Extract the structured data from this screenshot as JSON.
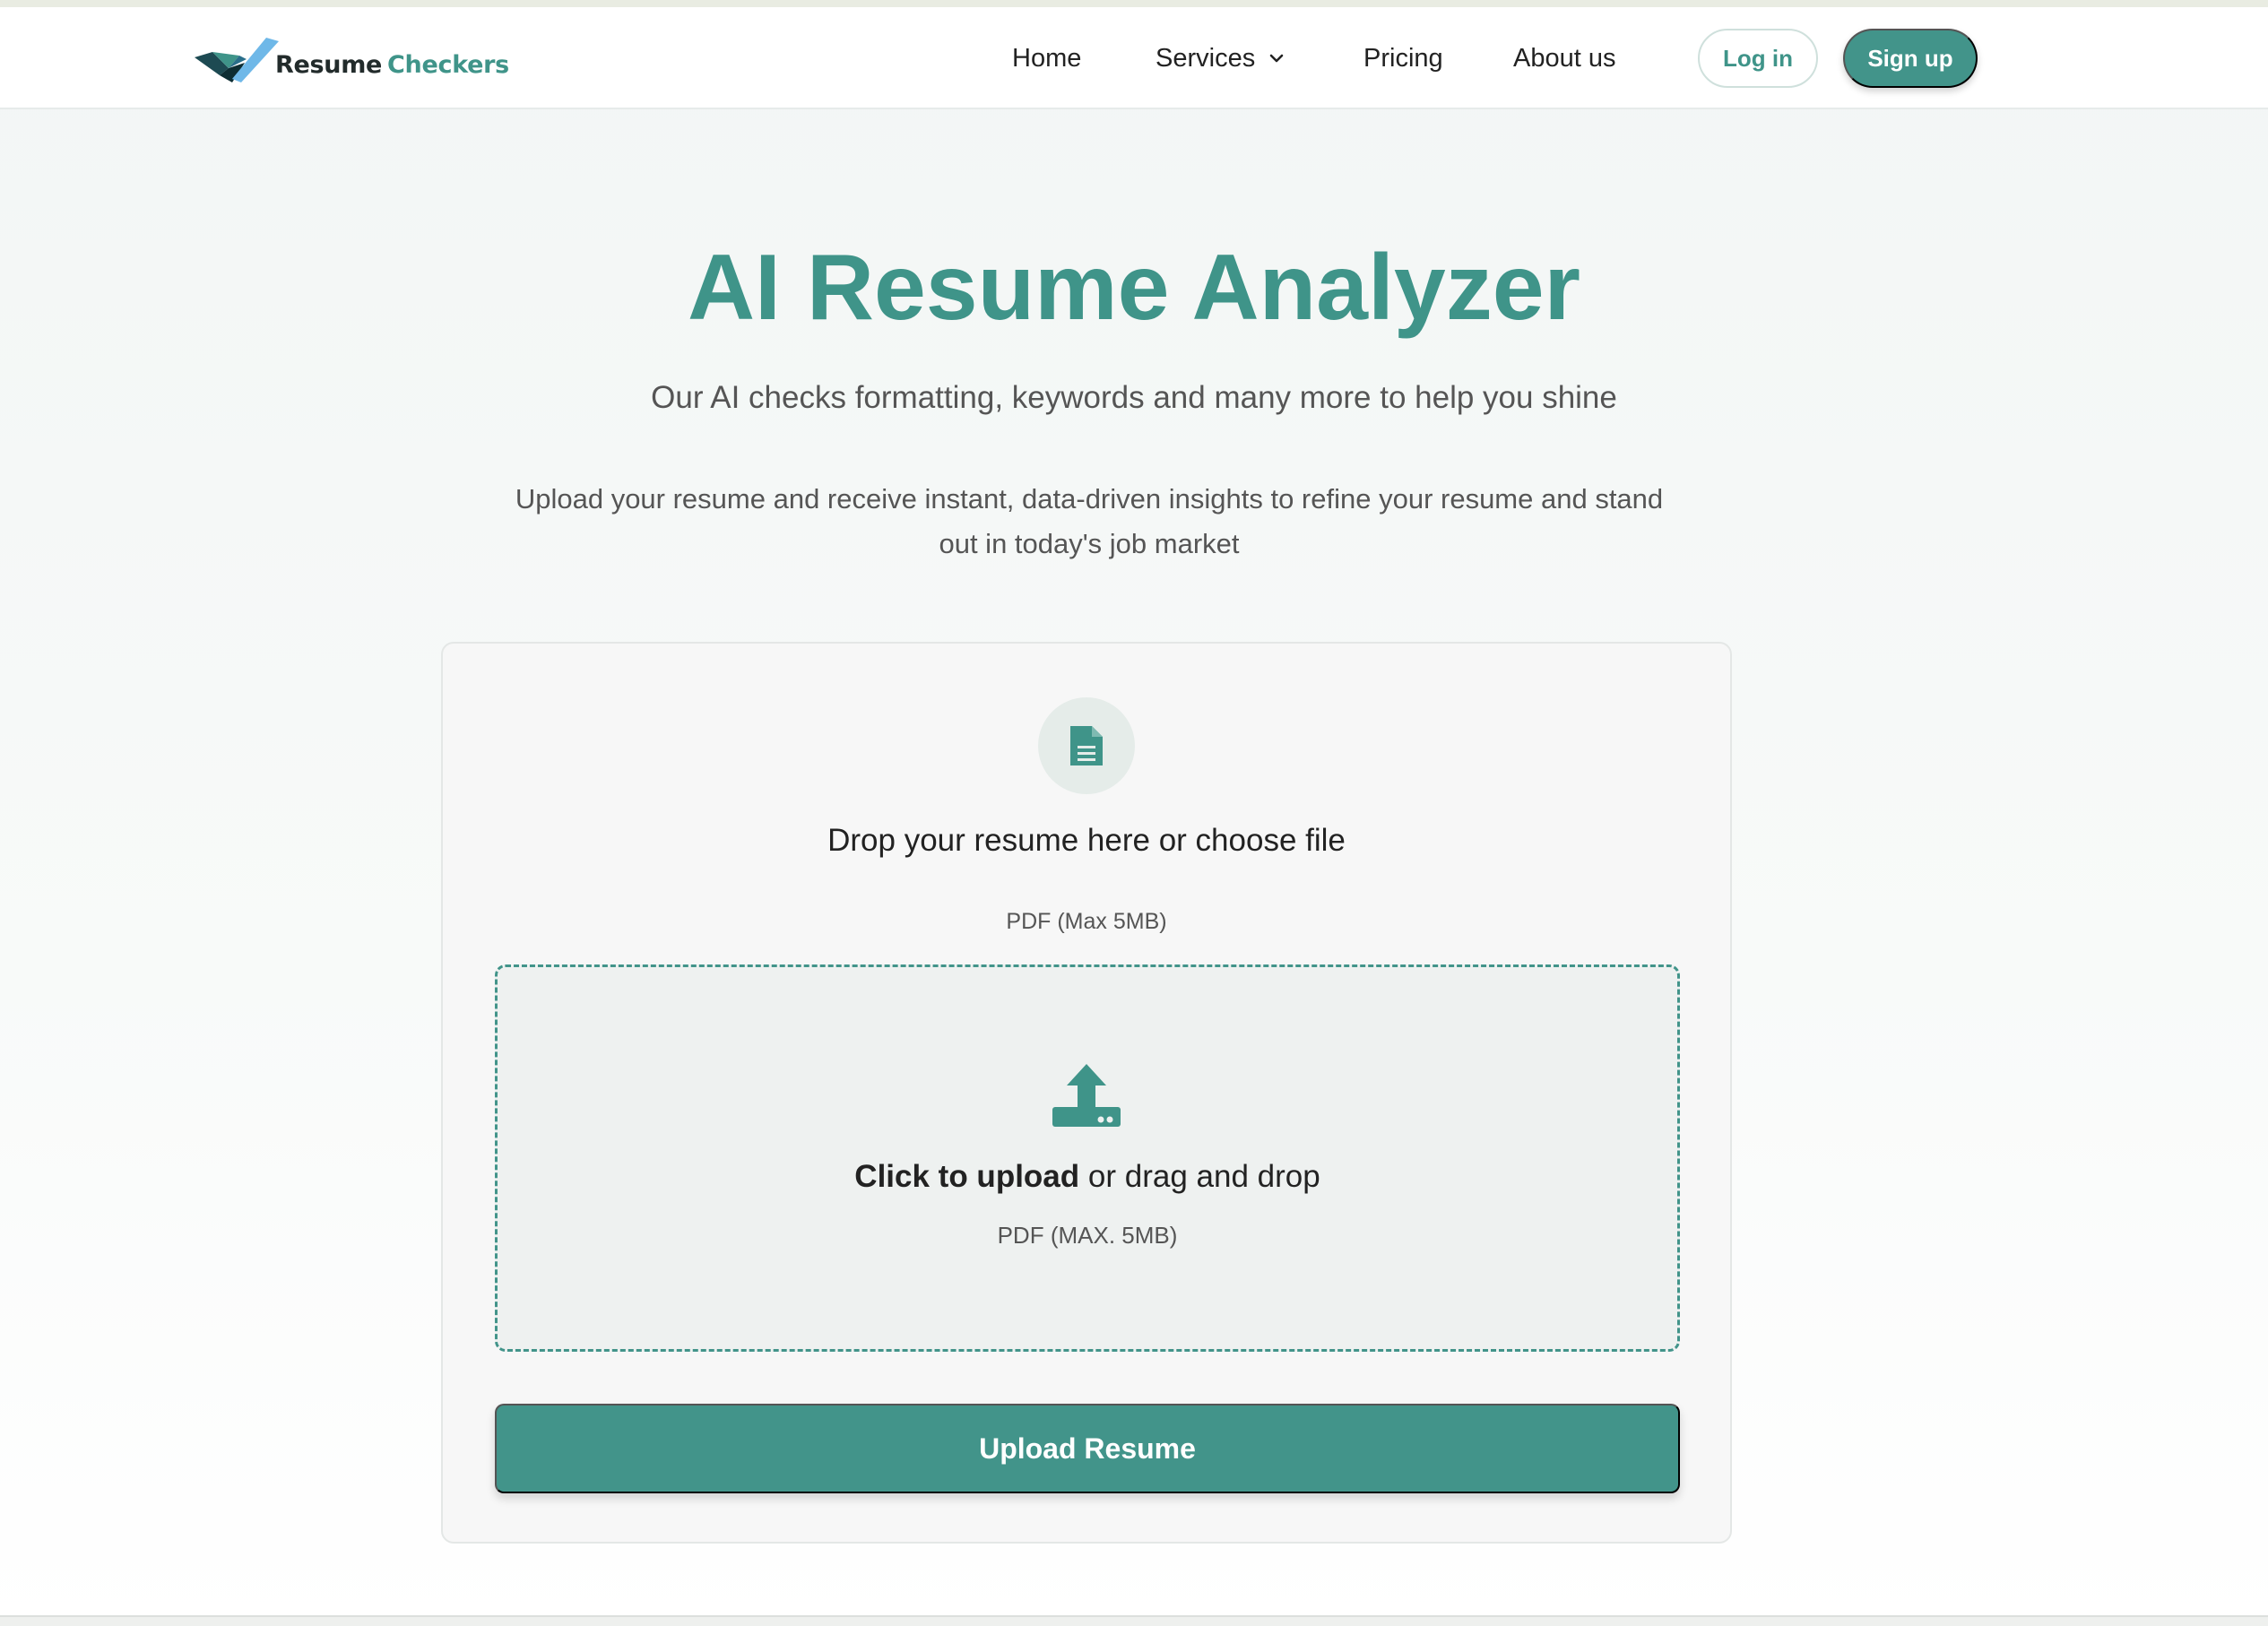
{
  "brand": {
    "name_part1": "Resume",
    "name_part2": "Checkers",
    "accent_color": "#42948a"
  },
  "nav": {
    "items": [
      {
        "label": "Home"
      },
      {
        "label": "Services",
        "has_dropdown": true
      },
      {
        "label": "Pricing"
      },
      {
        "label": "About us"
      }
    ],
    "login_label": "Log in",
    "signup_label": "Sign up"
  },
  "hero": {
    "title": "AI Resume Analyzer",
    "subtitle": "Our AI checks formatting, keywords and many more to help you shine",
    "description": "Upload your resume and receive instant, data-driven insights to refine your resume and stand out in today's job market"
  },
  "upload_card": {
    "icon": "document-icon",
    "title": "Drop your resume here or choose file",
    "note": "PDF (Max 5MB)",
    "dropzone": {
      "icon": "upload-icon",
      "action_bold": "Click to upload",
      "action_rest": "or drag and drop",
      "note": "PDF (MAX. 5MB)"
    },
    "button_label": "Upload Resume"
  }
}
